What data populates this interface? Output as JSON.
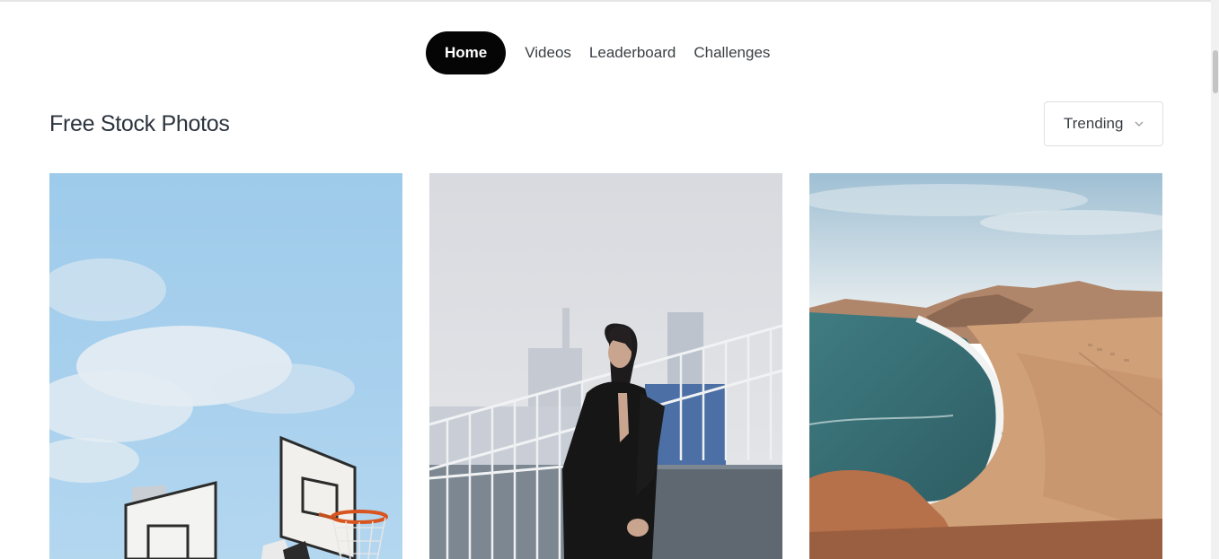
{
  "nav": {
    "tabs": [
      {
        "label": "Home",
        "active": true
      },
      {
        "label": "Videos",
        "active": false
      },
      {
        "label": "Leaderboard",
        "active": false
      },
      {
        "label": "Challenges",
        "active": false
      }
    ]
  },
  "page": {
    "title": "Free Stock Photos"
  },
  "sort": {
    "selected": "Trending"
  },
  "icons": {
    "sort_chevron": "chevron-down-icon"
  },
  "colors": {
    "active_tab_bg": "#050505",
    "active_tab_text": "#ffffff",
    "title_text": "#2c343e"
  }
}
